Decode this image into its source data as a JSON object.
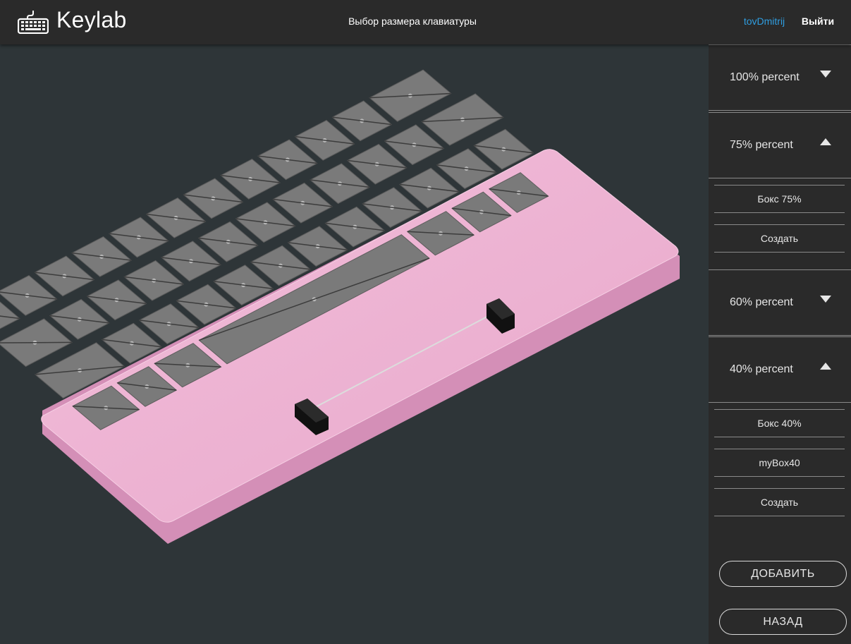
{
  "header": {
    "app_name": "Keylab",
    "page_title": "Выбор размера клавиатуры",
    "username": "tovDmitrij",
    "logout_label": "Выйти"
  },
  "sidebar": {
    "sections": [
      {
        "label": "100% percent",
        "expanded": false,
        "items": []
      },
      {
        "label": "75% percent",
        "expanded": true,
        "items": [
          "Бокс 75%",
          "Создать"
        ]
      },
      {
        "label": "60% percent",
        "expanded": false,
        "items": []
      },
      {
        "label": "40% percent",
        "expanded": true,
        "items": [
          "Бокс 40%",
          "myBox40",
          "Создать"
        ]
      }
    ],
    "add_label": "ДОБАВИТЬ",
    "back_label": "НАЗАД"
  },
  "scene": {
    "object": "keyboard-box-3d",
    "case_color": "#efb6d6",
    "plate_color": "#7a7a7a",
    "background_color": "#2e3538"
  }
}
